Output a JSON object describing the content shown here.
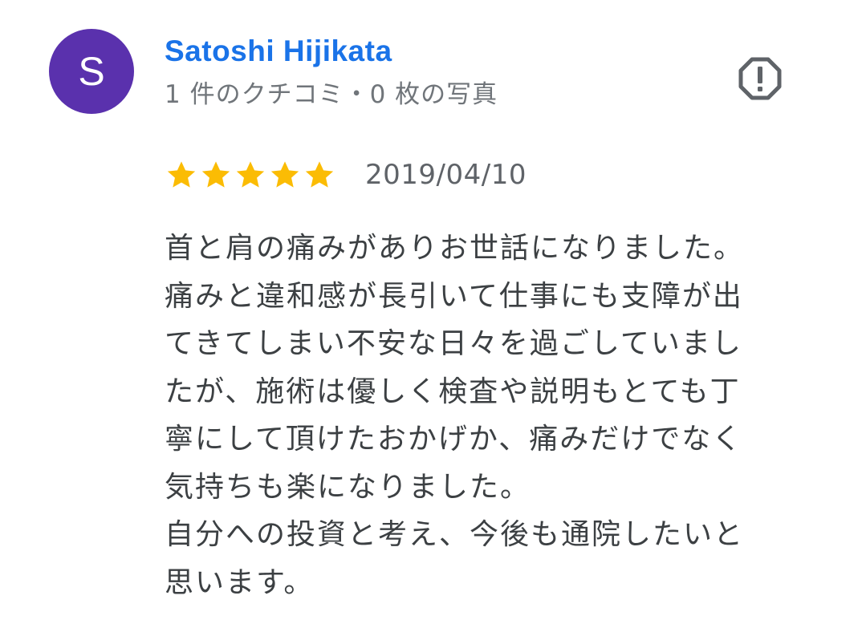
{
  "reviewer": {
    "avatar_initial": "S",
    "avatar_color": "#5a31ad",
    "name": "Satoshi Hijikata",
    "name_color": "#1a73e8",
    "meta": "1 件のクチコミ・0 枚の写真"
  },
  "actions": {
    "report_icon": "report-flag-octagon-icon"
  },
  "review": {
    "rating": 5,
    "rating_max": 5,
    "star_color": "#fbbc04",
    "date": "2019/04/10",
    "text_lines": [
      "首と肩の痛みがありお世話になりました。",
      "痛みと違和感が長引いて仕事にも支障が出",
      "てきてしまい不安な日々を過ごしていまし",
      "たが、施術は優しく検査や説明もとても丁",
      "寧にして頂けたおかげか、痛みだけでなく",
      "気持ちも楽になりました。",
      "自分への投資と考え、今後も通院したいと",
      "思います。"
    ]
  }
}
